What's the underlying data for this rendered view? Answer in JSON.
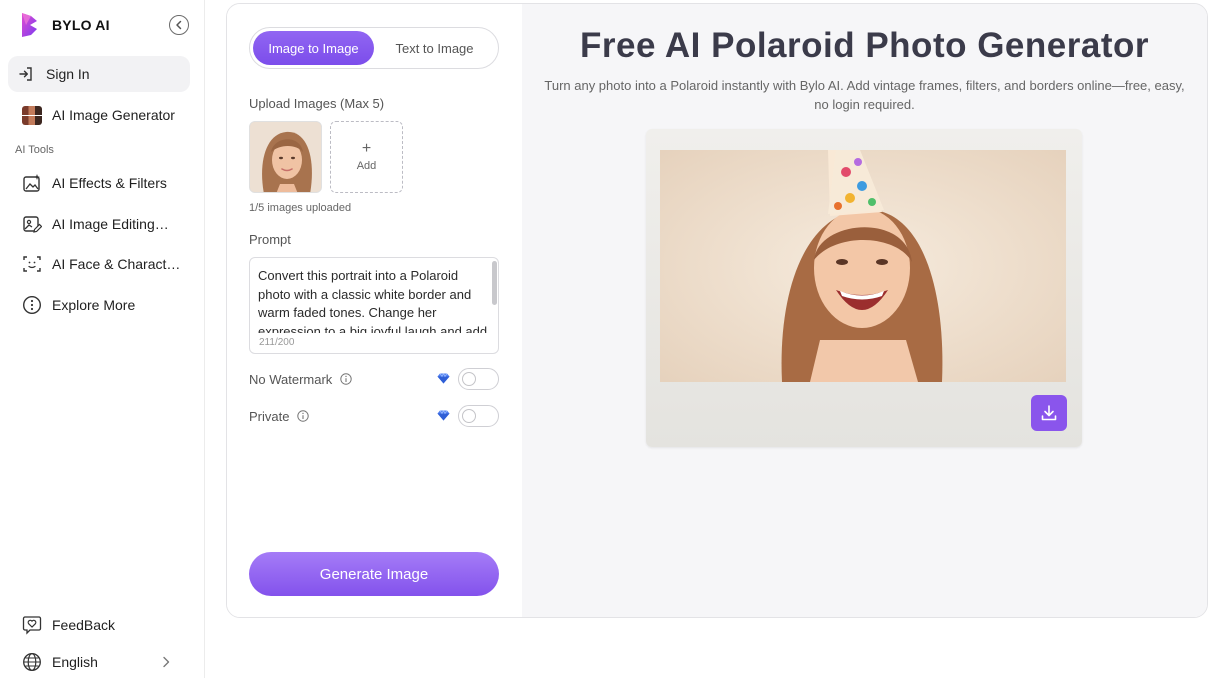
{
  "brand": {
    "name": "BYLO AI"
  },
  "sidebar": {
    "sign_in": "Sign In",
    "primary": {
      "label": "AI Image Generator",
      "icon": "image-grid-icon"
    },
    "section_label": "AI Tools",
    "tools": [
      {
        "label": "AI Effects & Filters",
        "icon": "sparkle-image-icon"
      },
      {
        "label": "AI Image Editing…",
        "icon": "image-edit-icon"
      },
      {
        "label": "AI Face & Charact…",
        "icon": "face-scan-icon"
      },
      {
        "label": "Explore More",
        "icon": "more-circle-icon"
      }
    ],
    "feedback": "FeedBack",
    "language": "English"
  },
  "generator": {
    "tabs": [
      "Image to Image",
      "Text to Image"
    ],
    "active_tab": "Image to Image",
    "upload_label": "Upload Images (Max 5)",
    "add_label": "Add",
    "upload_count": "1/5 images uploaded",
    "prompt_label": "Prompt",
    "prompt_value": "Convert this portrait into a Polaroid photo with a classic white border and warm faded tones. Change her expression to a big joyful laugh and add",
    "char_count": "211/200",
    "options": [
      {
        "label": "No Watermark",
        "enabled": false
      },
      {
        "label": "Private",
        "enabled": false
      }
    ],
    "generate_label": "Generate Image"
  },
  "hero": {
    "title": "Free AI Polaroid Photo Generator",
    "subtitle": "Turn any photo into a Polaroid instantly with Bylo AI. Add vintage frames, filters, and borders online—free, easy, no login required."
  },
  "colors": {
    "accent": "#8b5cf6",
    "panel_bg": "#f6f6f8",
    "border": "#e3e3e6"
  }
}
